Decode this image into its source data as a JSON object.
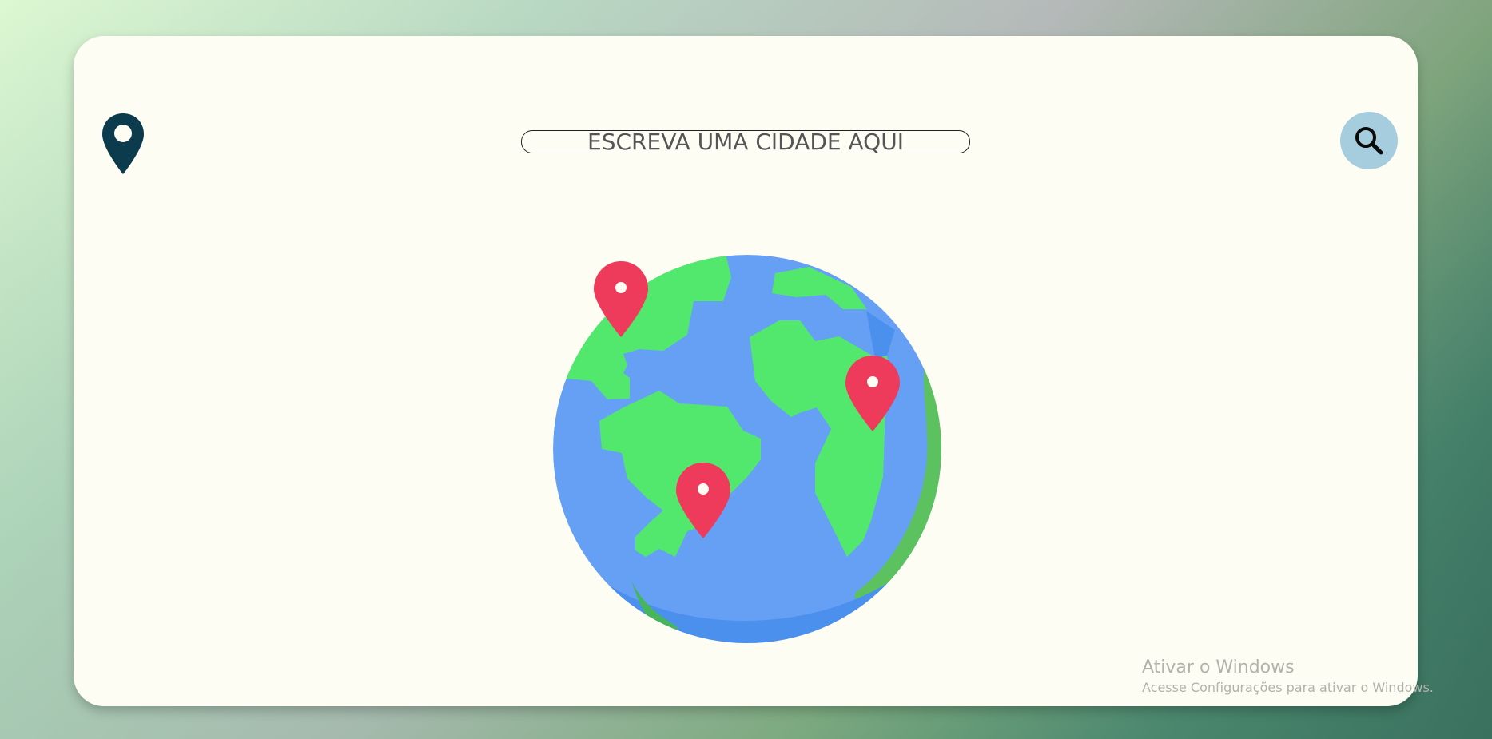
{
  "search": {
    "placeholder": "ESCREVA UMA CIDADE AQUI",
    "value": ""
  },
  "icons": {
    "logo": "map-pin-icon",
    "search_button": "search-icon",
    "illustration": "globe-with-pins"
  },
  "watermark": {
    "title": "Ativar o Windows",
    "subtitle": "Acesse Configurações para ativar o Windows."
  },
  "colors": {
    "card_background": "#fdfdf3",
    "logo_pin": "#0b3b4c",
    "search_button_bg": "#a6cddd",
    "globe_ocean": "#66a0f5",
    "globe_land": "#52e86e",
    "globe_pin": "#ee3b5c"
  }
}
